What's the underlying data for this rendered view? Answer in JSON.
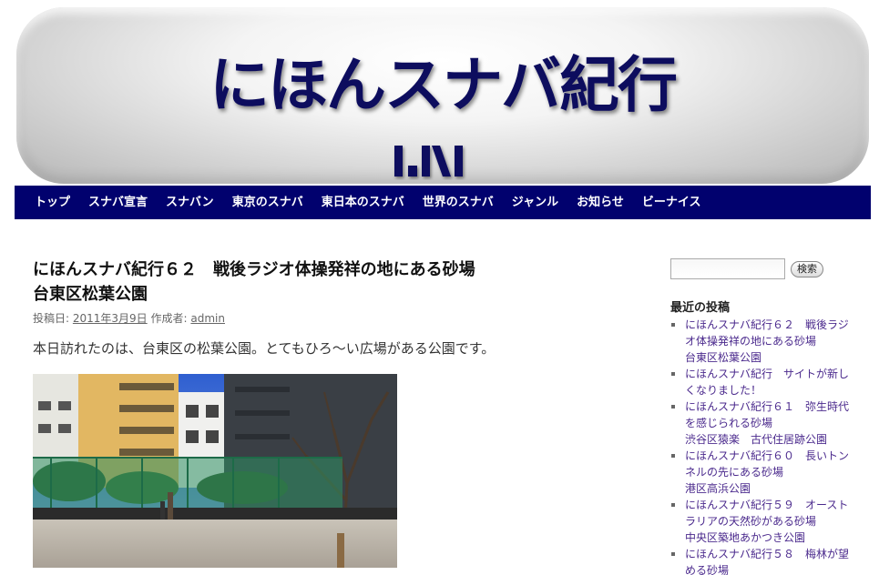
{
  "header": {
    "site_title": "にほんスナバ紀行"
  },
  "nav": {
    "items": [
      "トップ",
      "スナバ宣言",
      "スナバン",
      "東京のスナバ",
      "東日本のスナバ",
      "世界のスナバ",
      "ジャンル",
      "お知らせ",
      "ビーナイス"
    ]
  },
  "post": {
    "title_line1": "にほんスナバ紀行６２　戦後ラジオ体操発祥の地にある砂場",
    "title_line2": "台東区松葉公園",
    "meta_posted_label": "投稿日:",
    "meta_date": "2011年3月9日",
    "meta_author_label": "作成者:",
    "meta_author": "admin",
    "body": "本日訪れたのは、台東区の松葉公園。とてもひろ〜い広場がある公園です。"
  },
  "sidebar": {
    "search_placeholder": "",
    "search_button": "検索",
    "recent_title": "最近の投稿",
    "recent_posts": [
      "にほんスナバ紀行６２　戦後ラジ\nオ体操発祥の地にある砂場\n台東区松葉公園",
      "にほんスナバ紀行　サイトが新し\nくなりました！",
      "にほんスナバ紀行６１　弥生時代\nを感じられる砂場\n渋谷区猿楽　古代住居跡公園",
      "にほんスナバ紀行６０　長いトン\nネルの先にある砂場\n港区高浜公園",
      "にほんスナバ紀行５９　オースト\nラリアの天然砂がある砂場\n中央区築地あかつき公園",
      "にほんスナバ紀行５８　梅林が望\nめる砂場"
    ]
  },
  "colors": {
    "nav_bg": "#01016e",
    "title_color": "#0d0d5e",
    "link_color": "#4b2a8d"
  }
}
